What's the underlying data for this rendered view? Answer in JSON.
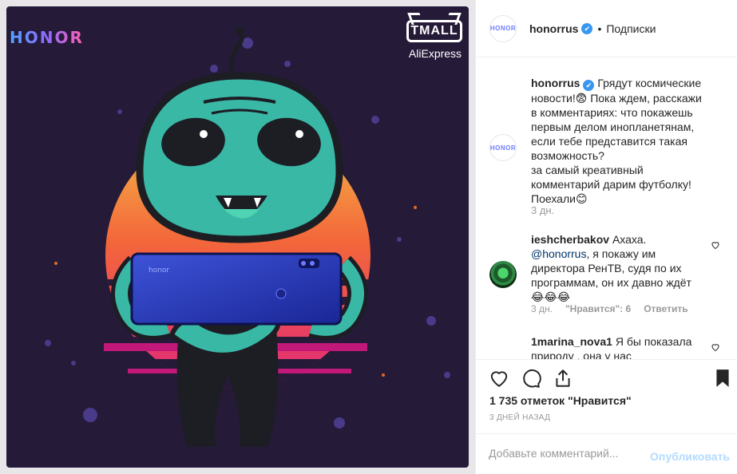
{
  "media": {
    "brand_logo": "HONOR",
    "tmall_label": "TMALL",
    "aliexpress_label": "AliExpress",
    "phone_logo": "honor"
  },
  "post": {
    "username": "honorrus",
    "avatar_text": "HONOR",
    "follow_label": "Подписки",
    "caption_text": "Грядут космические новости!😨 Пока ждем, расскажи в комментариях: что покажешь первым делом инопланетянам, если тебе представится такая возможность?\nза самый креативный комментарий дарим футболку! Поехали😊",
    "caption_time": "3 дн."
  },
  "comments": [
    {
      "username": "ieshcherbakov",
      "text_before": "Ахаха.",
      "mention": "@honorrus",
      "text_after": ", я покажу им директора РенТВ, судя по их программам, он их давно ждёт 😂😂😂",
      "time": "3 дн.",
      "likes": "\"Нравится\": 6",
      "reply": "Ответить"
    },
    {
      "username": "1marina_nova1",
      "text": "Я бы показала природу , она у нас"
    }
  ],
  "likes_count": "1 735 отметок \"Нравится\"",
  "post_date": "3 ДНЕЙ НАЗАД",
  "add_comment": {
    "placeholder": "Добавьте комментарий...",
    "publish_label": "Опубликовать"
  },
  "colors": {
    "verified": "#3897f0",
    "publish_disabled": "#b3dbff",
    "alien_skin": "#38b8a8",
    "phone": "#2a3bb8"
  },
  "icons": [
    "verified-badge-icon",
    "heart-icon",
    "comment-icon",
    "share-icon",
    "bookmark-icon"
  ]
}
